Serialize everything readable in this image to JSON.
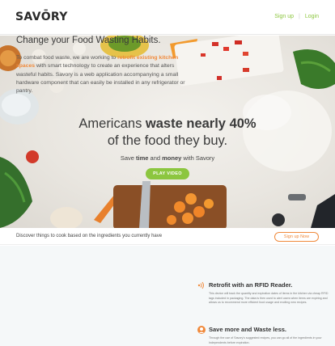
{
  "header": {
    "logo": "SAVŌRY",
    "nav": {
      "signup": "Sign up",
      "separator": "|",
      "login": "Login"
    }
  },
  "hero": {
    "title_part1": "Americans ",
    "title_bold": "waste nearly 40%",
    "title_line2": "of the food they buy.",
    "subtitle_part1": "Save ",
    "subtitle_bold1": "time",
    "subtitle_part2": " and ",
    "subtitle_bold2": "money",
    "subtitle_part3": " with Savory",
    "play_button": "PLAY VIDEO"
  },
  "discover": {
    "text": "Discover things to cook based on the ingredients you currently have",
    "button": "Sign up Now"
  },
  "lower": {
    "title": "Change your Food Wasting Habits.",
    "body_part1": "To combat food waste, we are working to ",
    "body_highlight": "retrofit existing kitchen spaces",
    "body_part2": " with smart technology to create an experience that alters wasteful habits. Savory is a web application accompanying a small hardware component that can easily be installed in any refrigerator or pantry.",
    "features": [
      {
        "icon": "rfid-signal-icon",
        "title": "Retrofit with an RFID Reader.",
        "body": "This device will track the quantity and expiration dates of items in the kitchen via cheap RFID tags included in packaging. The data is then used to alert users when items are expiring and allows us to recommend more efficient food usage and exciting new recipes."
      },
      {
        "icon": "chef-avatar-icon",
        "title": "Save more and Waste less.",
        "body": "Through the use of Savory's suggested recipes, you can go all of the ingredients in your Independents before expiration."
      }
    ]
  },
  "colors": {
    "accent_green": "#8cc63f",
    "accent_orange": "#f08a3c"
  }
}
